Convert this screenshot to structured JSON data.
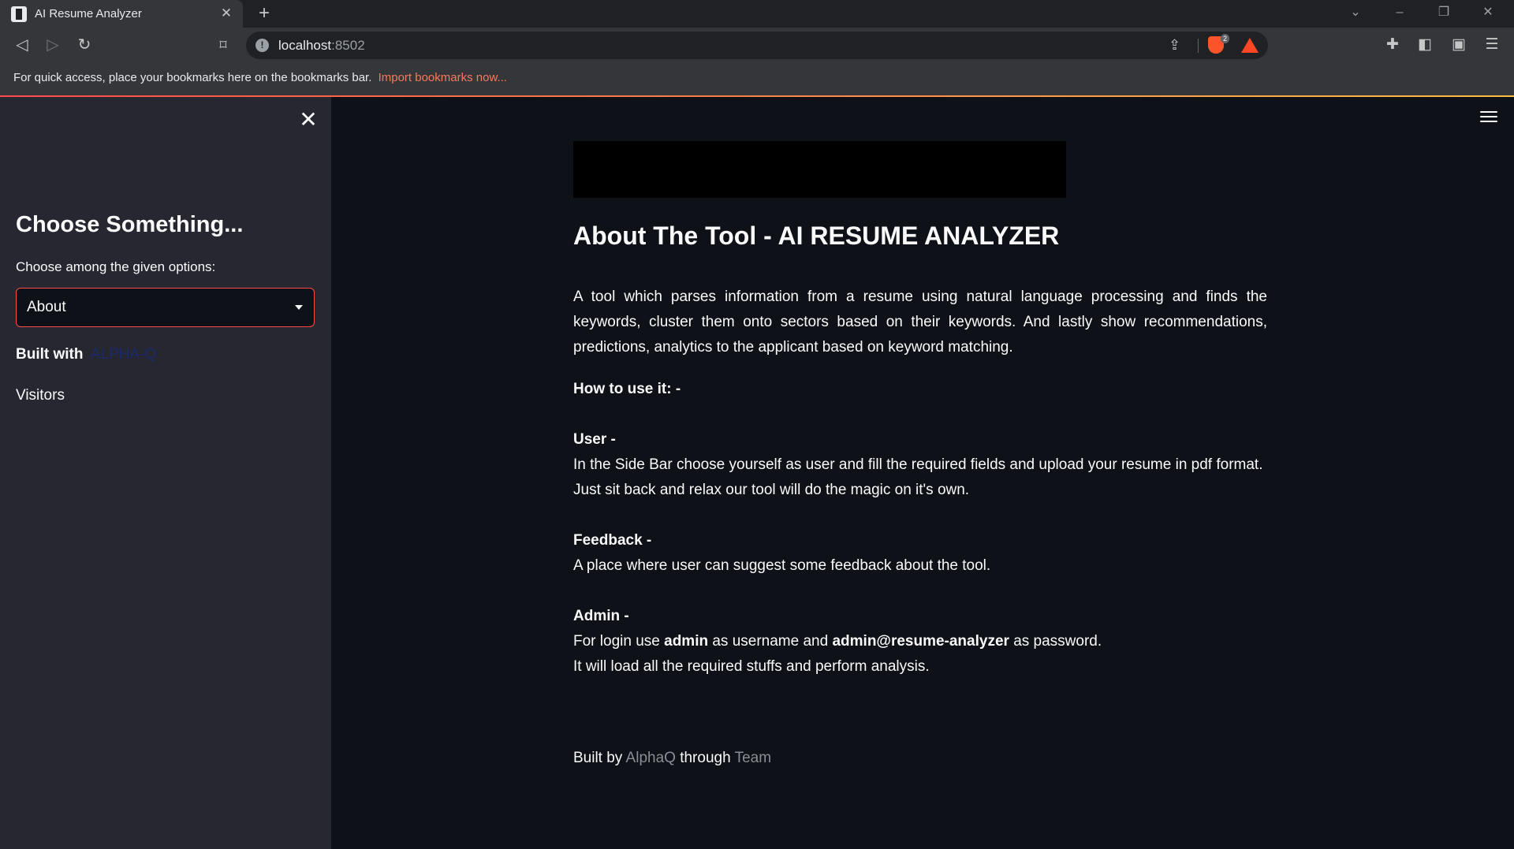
{
  "browser": {
    "tab_title": "AI Resume Analyzer",
    "url_host": "localhost",
    "url_port": ":8502",
    "bookmarks_text": "For quick access, place your bookmarks here on the bookmarks bar.",
    "bookmarks_link": "Import bookmarks now...",
    "brave_shield_count": "2",
    "icons": [
      "back-icon",
      "forward-icon",
      "reload-icon",
      "bookmark-icon",
      "info-icon",
      "share-icon",
      "brave-shields-icon",
      "brave-rewards-icon",
      "extensions-icon",
      "sidebar-icon",
      "wallet-icon",
      "menu-icon"
    ]
  },
  "sidebar": {
    "heading": "Choose Something...",
    "select_label": "Choose among the given options:",
    "select_value": "About",
    "built_with_label": "Built with",
    "built_with_link": "ALPHA-Q",
    "visitors_label": "Visitors"
  },
  "main": {
    "title": "About The Tool - AI RESUME ANALYZER",
    "intro": "A tool which parses information from a resume using natural language processing and finds the keywords, cluster them onto sectors based on their keywords. And lastly show recommendations, predictions, analytics to the applicant based on keyword matching.",
    "how_to_heading": "How to use it: -",
    "user_heading": "User -",
    "user_line1": "In the Side Bar choose yourself as user and fill the required fields and upload your resume in pdf format.",
    "user_line2": "Just sit back and relax our tool will do the magic on it's own.",
    "feedback_heading": "Feedback -",
    "feedback_line": "A place where user can suggest some feedback about the tool.",
    "admin_heading": "Admin -",
    "admin_pre": "For login use",
    "admin_username": "admin",
    "admin_mid": "as username and",
    "admin_password": "admin@resume-analyzer",
    "admin_post": "as password.",
    "admin_line2": "It will load all the required stuffs and perform analysis.",
    "footer_built_by": "Built by",
    "footer_author": "AlphaQ",
    "footer_through": "through",
    "footer_team": "Team"
  },
  "colors": {
    "accent": "#ff4b4b",
    "app_bg": "#0e1117",
    "sidebar_bg": "#262730",
    "link_muted": "#8a8d93",
    "bookmark_link": "#f47a5c"
  }
}
